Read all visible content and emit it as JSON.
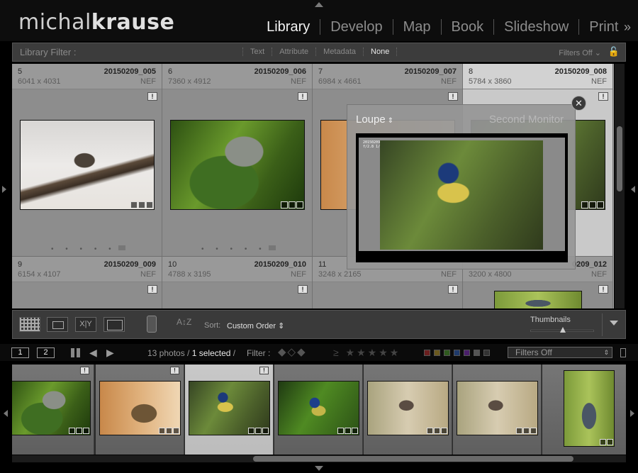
{
  "brand": {
    "part1": "michal",
    "part2": "krause"
  },
  "modules": [
    {
      "label": "Library",
      "active": true
    },
    {
      "label": "Develop",
      "active": false
    },
    {
      "label": "Map",
      "active": false
    },
    {
      "label": "Book",
      "active": false
    },
    {
      "label": "Slideshow",
      "active": false
    },
    {
      "label": "Print",
      "active": false
    }
  ],
  "module_more": "»",
  "filter_bar": {
    "title": "Library Filter :",
    "options": [
      "Text",
      "Attribute",
      "Metadata",
      "None"
    ],
    "active": "None",
    "status": "Filters Off",
    "status_arrow": "⌄",
    "lock_icon": "🔓"
  },
  "grid": {
    "cells": [
      {
        "num": "5",
        "name": "20150209_005",
        "dims": "6041 x 4031",
        "ext": "NEF",
        "flag": "!"
      },
      {
        "num": "6",
        "name": "20150209_006",
        "dims": "7360 x 4912",
        "ext": "NEF",
        "flag": "!"
      },
      {
        "num": "7",
        "name": "20150209_007",
        "dims": "6984 x 4661",
        "ext": "NEF",
        "flag": "!"
      },
      {
        "num": "8",
        "name": "20150209_008",
        "dims": "5784 x 3860",
        "ext": "NEF",
        "flag": "!"
      },
      {
        "num": "9",
        "name": "20150209_009",
        "dims": "6154 x 4107",
        "ext": "NEF",
        "flag": "!"
      },
      {
        "num": "10",
        "name": "20150209_010",
        "dims": "4788 x 3195",
        "ext": "NEF",
        "flag": "!"
      },
      {
        "num": "11",
        "name": "",
        "dims": "3248 x 2165",
        "ext": "NEF",
        "flag": "!"
      },
      {
        "num": "",
        "name": "0209_012",
        "dims": "3200 x 4800",
        "ext": "NEF",
        "flag": "!"
      }
    ],
    "selected_index": 3,
    "dots": "• • • • •"
  },
  "loupe_popup": {
    "title": "Loupe",
    "title_arrow": "⇕",
    "second_monitor": "Second Monitor",
    "close": "✕",
    "overlay_line1": "20150209_008.NEF",
    "overlay_line2": "f/2.8 1/500 ISO 800"
  },
  "toolbar": {
    "xy_label": "X|Y",
    "sort_dir": "A↕Z",
    "sort_label": "Sort:",
    "sort_value": "Custom Order ⇕",
    "thumbnails_label": "Thumbnails",
    "thumbnail_size": 0.5
  },
  "filmstrip_bar": {
    "monitor1": "1",
    "monitor2": "2",
    "prev": "◀",
    "next": "▶",
    "count_prefix": "13 photos /",
    "count_selected": "1 selected",
    "count_suffix": "/",
    "filter_label": "Filter :",
    "flags": "◆◇◆",
    "rating_prefix": "≥",
    "stars": "★★★★★",
    "filter_select": "Filters Off",
    "select_arrow": "⇕",
    "label_colors": [
      "#6b1f1f",
      "#6b5a1f",
      "#2f5a1f",
      "#1f3a6b",
      "#4a1f6b",
      "#555555",
      "#333333"
    ]
  },
  "filmstrip": {
    "selected_index": 2,
    "flag": "!"
  }
}
